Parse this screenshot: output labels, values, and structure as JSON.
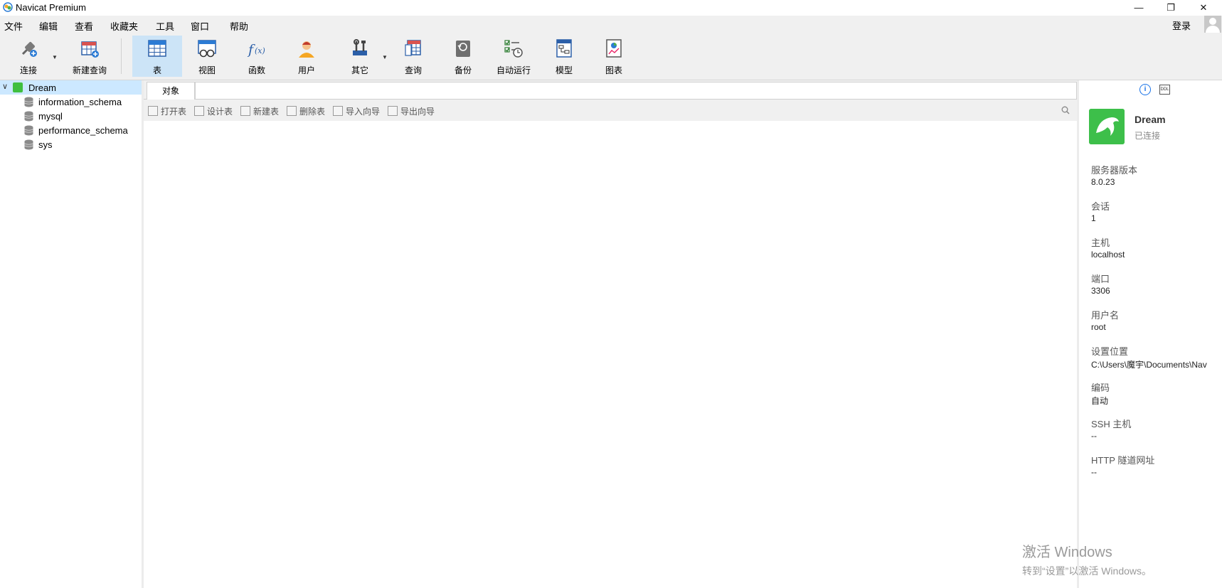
{
  "window": {
    "title": "Navicat Premium",
    "controls": {
      "minimize": "—",
      "restore": "❐",
      "close": "✕"
    }
  },
  "menu": {
    "items": [
      "文件",
      "编辑",
      "查看",
      "收藏夹",
      "工具",
      "窗口",
      "帮助"
    ],
    "login": "登录"
  },
  "toolbar": {
    "items": [
      {
        "label": "连接",
        "icon": "connect-icon"
      },
      {
        "label": "新建查询",
        "icon": "new-query-icon"
      },
      {
        "label": "表",
        "icon": "table-icon",
        "active": true
      },
      {
        "label": "视图",
        "icon": "view-icon"
      },
      {
        "label": "函数",
        "icon": "function-icon"
      },
      {
        "label": "用户",
        "icon": "user-icon"
      },
      {
        "label": "其它",
        "icon": "others-icon"
      },
      {
        "label": "查询",
        "icon": "query-icon"
      },
      {
        "label": "备份",
        "icon": "backup-icon"
      },
      {
        "label": "自动运行",
        "icon": "automation-icon"
      },
      {
        "label": "模型",
        "icon": "model-icon"
      },
      {
        "label": "图表",
        "icon": "chart-icon"
      }
    ]
  },
  "sidebar": {
    "connection": "Dream",
    "databases": [
      "information_schema",
      "mysql",
      "performance_schema",
      "sys"
    ]
  },
  "main": {
    "tab": "对象",
    "object_toolbar": [
      "打开表",
      "设计表",
      "新建表",
      "删除表",
      "导入向导",
      "导出向导"
    ]
  },
  "info_panel": {
    "name": "Dream",
    "status": "已连接",
    "properties": [
      {
        "label": "服务器版本",
        "value": "8.0.23"
      },
      {
        "label": "会话",
        "value": "1"
      },
      {
        "label": "主机",
        "value": "localhost"
      },
      {
        "label": "端口",
        "value": "3306"
      },
      {
        "label": "用户名",
        "value": "root"
      },
      {
        "label": "设置位置",
        "value": "C:\\Users\\魔宇\\Documents\\Nav"
      },
      {
        "label": "编码",
        "value": "自动"
      },
      {
        "label": "SSH 主机",
        "value": "--"
      },
      {
        "label": "HTTP 隧道网址",
        "value": "--"
      }
    ]
  },
  "watermark": {
    "line1": "激活 Windows",
    "line2": "转到“设置”以激活 Windows。"
  },
  "colors": {
    "active_tool": "#cce4f7",
    "selected_tree_row": "#cce8ff",
    "connection_green": "#3dbf4a",
    "info_blue": "#1a73e8"
  }
}
